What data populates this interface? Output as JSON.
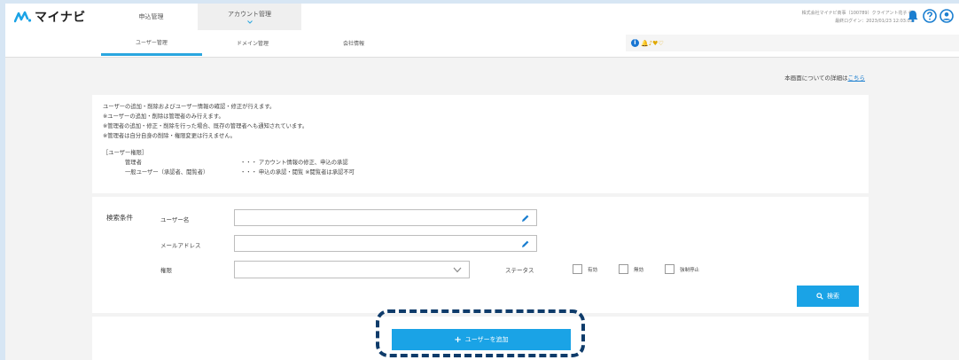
{
  "brand": {
    "logo_text": "マイナビ"
  },
  "header": {
    "tabs": [
      {
        "label": "申込管理"
      },
      {
        "label": "アカウント管理"
      }
    ],
    "account_line1": "株式会社マイナビ商事（100789）クライアント花子 様",
    "account_line2": "最終ログイン：2023/01/23 12:03:03"
  },
  "subnav": {
    "tabs": [
      {
        "label": "ユーザー管理"
      },
      {
        "label": "ドメイン管理"
      },
      {
        "label": "会社情報"
      }
    ],
    "notice_glyphs": "🔔♪♥♡"
  },
  "detail": {
    "prefix": "本画面についての詳細は",
    "link": "こちら"
  },
  "description": {
    "line1": "ユーザーの追加・削除およびユーザー情報の確認・修正が行えます。",
    "line2": "※ユーザーの追加・削除は管理者のみ行えます。",
    "line3": "※管理者の追加・修正・削除を行った場合、既存の管理者へも通知されています。",
    "line4": "※管理者は自分自身の削除・権限変更は行えません。",
    "roles_heading": "［ユーザー権限］",
    "roles": [
      {
        "name": "管理者",
        "desc": "・・・ アカウント情報の修正、申込の承認"
      },
      {
        "name": "一般ユーザー（承認者、閲覧者）",
        "desc": "・・・ 申込の承認・閲覧 ※閲覧者は承認不可"
      }
    ]
  },
  "search": {
    "title": "検索条件",
    "username_label": "ユーザー名",
    "email_label": "メールアドレス",
    "role_label": "権限",
    "role_value": "",
    "status_label": "ステータス",
    "status_options": [
      {
        "label": "有効"
      },
      {
        "label": "無効"
      },
      {
        "label": "強制停止"
      }
    ],
    "button_label": "検索"
  },
  "add": {
    "button_label": "ユーザーを追加"
  },
  "colors": {
    "accent": "#1aa3e6",
    "tab_underline": "#2aa6df",
    "highlight_dash": "#0e3b6a"
  }
}
